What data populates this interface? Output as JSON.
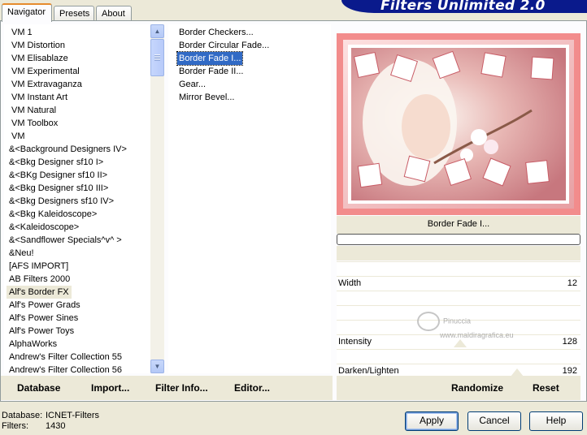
{
  "tabs": [
    "Navigator",
    "Presets",
    "About"
  ],
  "title": "Filters Unlimited 2.0",
  "categories": [
    "VM 1",
    "VM Distortion",
    "VM Elisablaze",
    "VM Experimental",
    "VM Extravaganza",
    "VM Instant Art",
    "VM Natural",
    "VM Toolbox",
    "VM",
    "&<Background Designers IV>",
    "&<Bkg Designer sf10 I>",
    "&<BKg Designer sf10 II>",
    "&<Bkg Designer sf10 III>",
    "&<Bkg Designers sf10 IV>",
    "&<Bkg Kaleidoscope>",
    "&<Kaleidoscope>",
    "&<Sandflower Specials^v^ >",
    "&Neu!",
    "[AFS IMPORT]",
    "AB Filters 2000",
    "Alf's Border FX",
    "Alf's Power Grads",
    "Alf's Power Sines",
    "Alf's Power Toys",
    "AlphaWorks",
    "Andrew's Filter Collection 55",
    "Andrew's Filter Collection 56"
  ],
  "selected_category": "Alf's Border FX",
  "filters": [
    "Border Checkers...",
    "Border Circular Fade...",
    "Border Fade I...",
    "Border Fade II...",
    "Gear...",
    "Mirror Bevel..."
  ],
  "selected_filter": "Border Fade I...",
  "left_buttons": {
    "database": "Database",
    "import": "Import...",
    "filter_info": "Filter Info...",
    "editor": "Editor..."
  },
  "current_filter_name": "Border Fade I...",
  "params": [
    {
      "label": "Width",
      "value": "12"
    },
    {
      "label": "Intensity",
      "value": "128"
    },
    {
      "label": "Darken/Lighten",
      "value": "192"
    }
  ],
  "right_buttons": {
    "randomize": "Randomize",
    "reset": "Reset"
  },
  "watermark": {
    "line1": "Pinuccia",
    "line2": "www.maldiragrafica.eu"
  },
  "status": {
    "db_label": "Database:",
    "db_value": "ICNET-Filters",
    "filters_label": "Filters:",
    "filters_value": "1430"
  },
  "dialog_buttons": {
    "apply": "Apply",
    "cancel": "Cancel",
    "help": "Help"
  },
  "colors": {
    "selection": "#316ac5",
    "banner": "#0a1a8c",
    "preview_frame": "#f28c8c",
    "window_bg": "#ece9d8"
  }
}
